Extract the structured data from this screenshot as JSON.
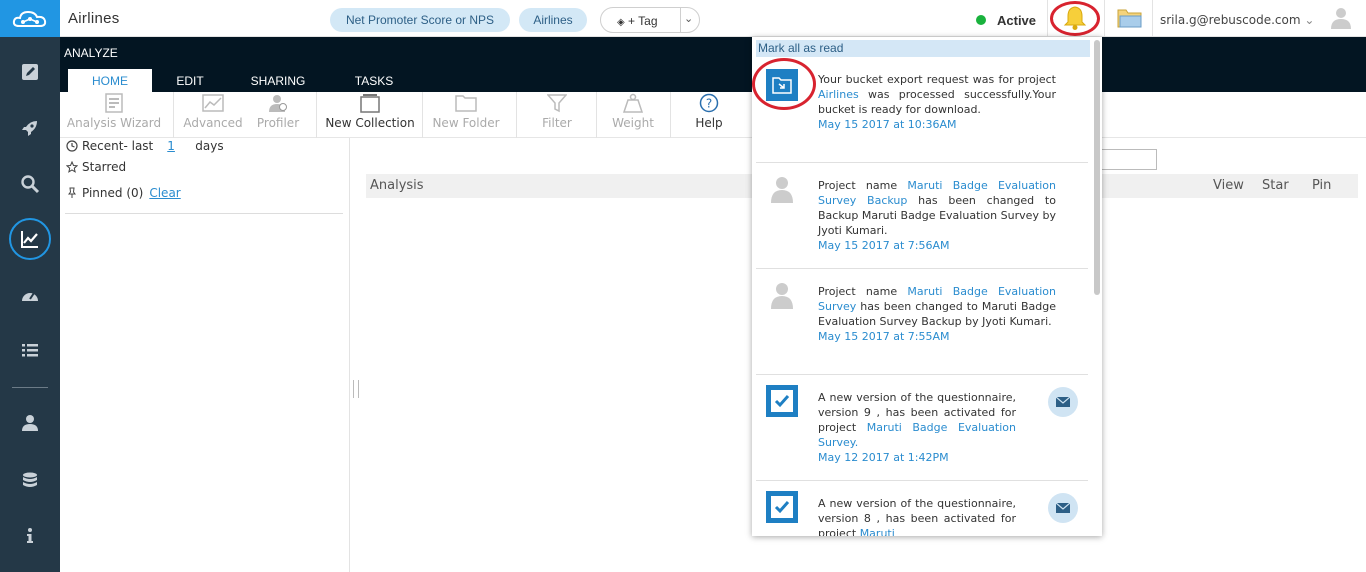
{
  "header": {
    "app_title": "Airlines",
    "pills": [
      "Net Promoter Score or NPS",
      "Airlines"
    ],
    "tag_label": "+ Tag",
    "status": "Active",
    "user_email": "srila.g@rebuscode.com"
  },
  "band": {
    "section": "ANALYZE",
    "tabs": [
      "HOME",
      "EDIT",
      "SHARING",
      "TASKS"
    ]
  },
  "ribbon": {
    "buttons": [
      "Analysis Wizard",
      "Advanced",
      "Profiler",
      "New Collection",
      "New Folder",
      "Filter",
      "Weight",
      "Help"
    ]
  },
  "left_panel": {
    "recent_label": "Recent- last",
    "recent_value": "1",
    "recent_unit": "days",
    "starred": "Starred",
    "pinned": "Pinned (0)",
    "clear": "Clear"
  },
  "table": {
    "columns": [
      "Analysis",
      "View",
      "Star",
      "Pin"
    ]
  },
  "notifications": {
    "mark_all": "Mark all as read",
    "items": [
      {
        "icon": "folder-export-icon",
        "text_a": "Your bucket export request was for project ",
        "link_a": "Airlines",
        "text_b": " was processed successfully.Your bucket is ready for download.",
        "time": "May 15 2017 at 10:36AM"
      },
      {
        "icon": "user-avatar-icon",
        "text_a": "Project name ",
        "link_a": "Maruti Badge Evaluation Survey Backup",
        "text_b": " has been changed to  Backup Maruti Badge Evaluation Survey by Jyoti Kumari.",
        "time": "May 15 2017 at 7:56AM"
      },
      {
        "icon": "user-avatar-icon",
        "text_a": "Project name ",
        "link_a": "Maruti Badge Evaluation Survey",
        "text_b": " has been changed to Maruti Badge Evaluation Survey Backup by Jyoti Kumari.",
        "time": "May 15 2017 at 7:55AM"
      },
      {
        "icon": "checkbox-icon",
        "text_a": "A new version of the questionnaire, version 9 , has been activated for project ",
        "link_a": "Maruti Badge Evaluation Survey.",
        "text_b": "",
        "time": "May 12 2017 at 1:42PM"
      },
      {
        "icon": "checkbox-icon",
        "text_a": "A new version of the questionnaire, version 8 , has been activated for project ",
        "link_a": "Maruti",
        "text_b": "",
        "time": ""
      }
    ]
  },
  "colors": {
    "accent": "#2196e3",
    "sidebar": "#243847",
    "band": "#031522",
    "highlight_ring": "#d8232f",
    "status_green": "#19b23d"
  }
}
